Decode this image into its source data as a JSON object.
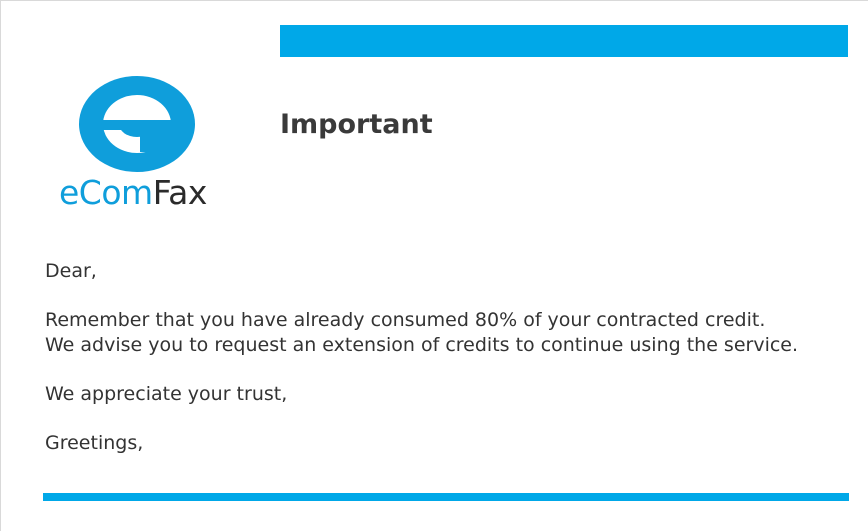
{
  "brand": {
    "logo_prefix": "eCom",
    "logo_suffix": "Fax",
    "accent_color": "#00a8e8",
    "logo_icon": "e-letter-logo-icon"
  },
  "header": {
    "title": "Important"
  },
  "message": {
    "greeting": "Dear,",
    "line1": "Remember that you have already consumed 80% of your contracted credit.",
    "line2": "We advise you to request an extension of credits to continue using the service.",
    "appreciation": "We appreciate your trust,",
    "closing": "Greetings,"
  }
}
